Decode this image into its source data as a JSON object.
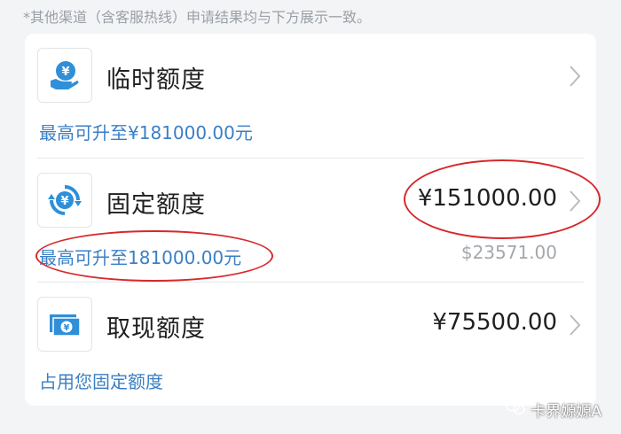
{
  "notice": "*其他渠道（含客服热线）申请结果均与下方展示一致。",
  "items": [
    {
      "title": "临时额度",
      "subtitle": "最高可升至¥181000.00元",
      "icon": "yen-hand-icon"
    },
    {
      "title": "固定额度",
      "subtitle": "最高可升至181000.00元",
      "amount": "¥151000.00",
      "secondary": "$23571.00",
      "icon": "yen-cycle-icon"
    },
    {
      "title": "取现额度",
      "subtitle": "占用您固定额度",
      "amount": "¥75500.00",
      "icon": "yen-banknote-icon"
    }
  ],
  "watermark": "卡界嫄嫄A",
  "colors": {
    "accent": "#3b7fc4",
    "icon": "#2f8fd8",
    "annotation": "#d7282b",
    "text": "#1f1f1f",
    "muted": "#a4a8ad"
  }
}
